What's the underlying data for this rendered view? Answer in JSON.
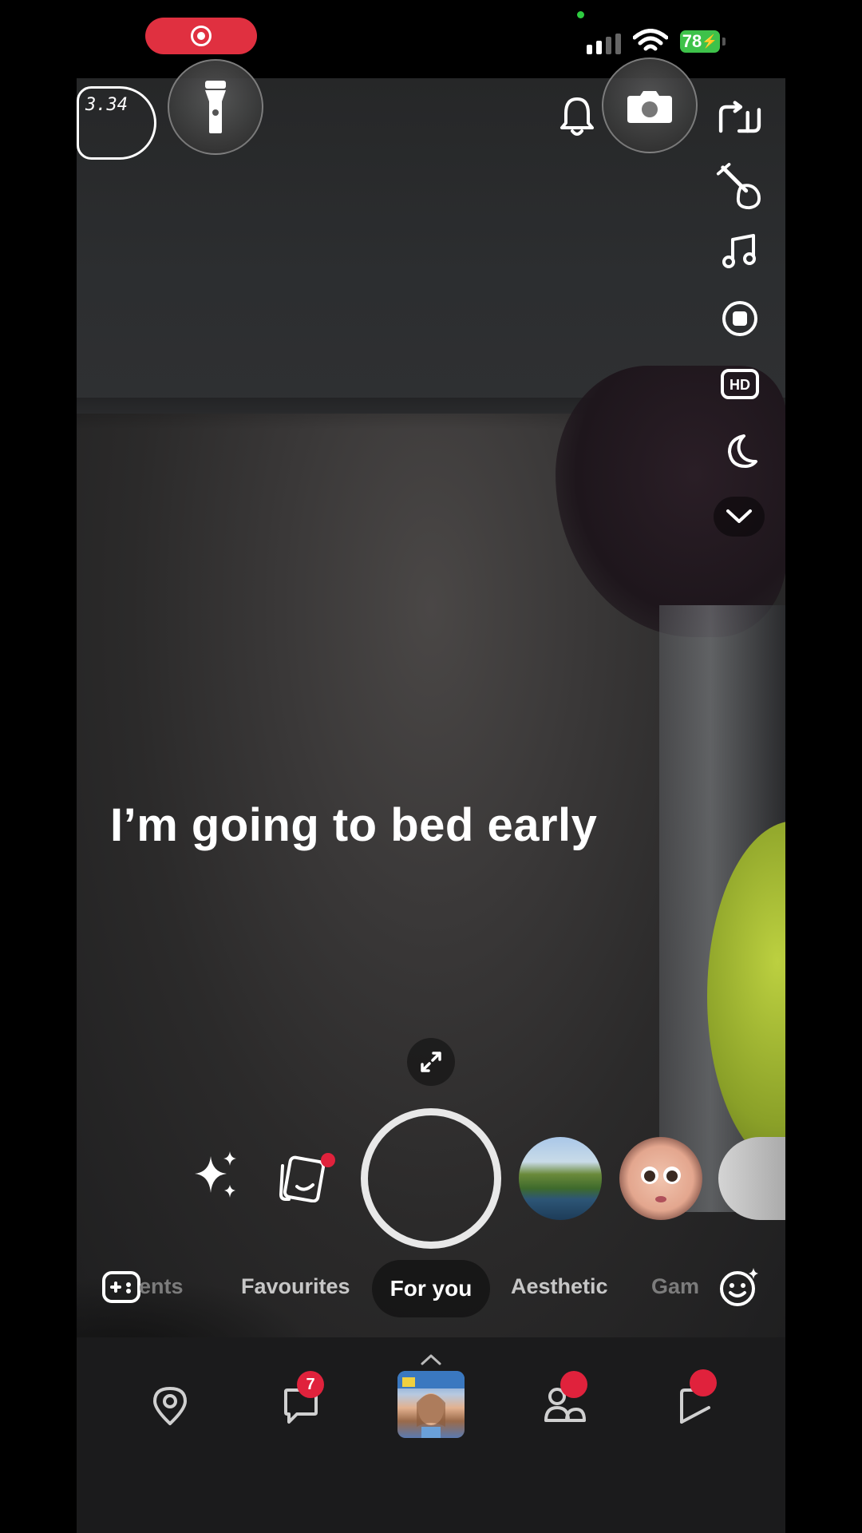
{
  "status_bar": {
    "battery_level": "78",
    "recording": true,
    "icons": [
      "screen-recording-icon",
      "cellular-signal-icon",
      "wifi-icon",
      "battery-icon"
    ]
  },
  "camera": {
    "clock_sticker_text": "3.34",
    "top_controls": [
      "flash-icon",
      "notification-bell-icon",
      "flip-camera-icon"
    ],
    "side_tools": [
      "rotate-icon",
      "guitar-icon",
      "music-note-icon",
      "record-stop-icon",
      "hd-icon",
      "night-mode-icon",
      "chevron-down-icon"
    ],
    "hd_label": "HD",
    "caption": "I’m going to bed early"
  },
  "capture_bar": {
    "left_icons": [
      "sparkle-icon",
      "memories-icon"
    ],
    "lens_thumbnails": [
      "landscape-lens",
      "baby-face-lens",
      "more-lens"
    ]
  },
  "categories": {
    "items": [
      "ents",
      "Favourites",
      "For you",
      "Aesthetic",
      "Gam"
    ],
    "active": "For you"
  },
  "bottom_nav": {
    "items": [
      "map-pin-icon",
      "chat-icon",
      "camera-avatar",
      "friends-icon",
      "stories-icon"
    ],
    "chat_badge": "7"
  },
  "colors": {
    "recording_red": "#e03040",
    "battery_green": "#3ec24a",
    "badge_red": "#e0223c",
    "nav_background": "#1b1b1c"
  }
}
